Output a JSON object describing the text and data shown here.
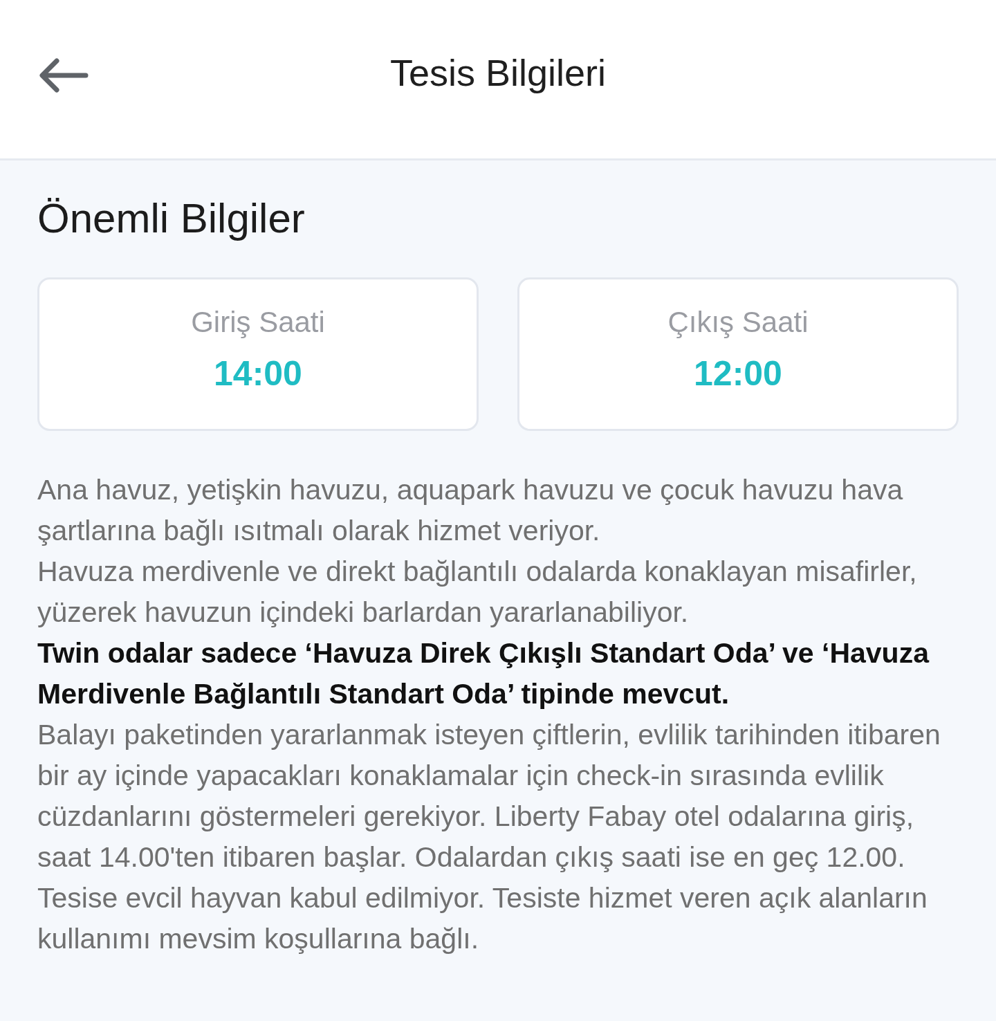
{
  "header": {
    "title": "Tesis Bilgileri"
  },
  "section": {
    "title": "Önemli Bilgiler"
  },
  "times": [
    {
      "label": "Giriş Saati",
      "value": "14:00"
    },
    {
      "label": "Çıkış Saati",
      "value": "12:00"
    }
  ],
  "paragraphs": [
    {
      "text": "Ana havuz, yetişkin havuzu, aquapark havuzu ve çocuk havuzu hava şartlarına bağlı ısıtmalı olarak hizmet veriyor.",
      "bold": false
    },
    {
      "text": "Havuza merdivenle ve direkt bağlantılı odalarda konaklayan misafirler, yüzerek havuzun içindeki barlardan yararlanabiliyor.",
      "bold": false
    },
    {
      "text": "Twin odalar sadece ‘Havuza Direk Çıkışlı Standart Oda’ ve ‘Havuza Merdivenle Bağlantılı Standart Oda’ tipinde mevcut.",
      "bold": true
    },
    {
      "text": "Balayı paketinden yararlanmak isteyen çiftlerin, evlilik tarihinden itibaren bir ay içinde yapacakları konaklamalar için check-in sırasında evlilik cüzdanlarını göstermeleri gerekiyor. Liberty Fabay otel odalarına giriş, saat 14.00'ten itibaren başlar. Odalardan çıkış saati ise en geç 12.00. Tesise evcil hayvan kabul edilmiyor. Tesiste hizmet veren açık alanların kullanımı mevsim koşullarına bağlı.",
      "bold": false
    }
  ]
}
